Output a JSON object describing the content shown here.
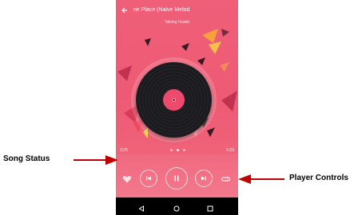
{
  "screen": {
    "song_title": "ne Place (Naive Melod",
    "artist": "Talking Heads",
    "elapsed_time": "3:25",
    "total_time": "6:23"
  },
  "annotations": {
    "song_status": "Song Status",
    "player_controls": "Player Controls"
  },
  "icons": {
    "back": "back-arrow-icon",
    "like": "heart-icon",
    "previous": "skip-previous-icon",
    "play_pause": "pause-icon",
    "next": "skip-next-icon",
    "repeat": "repeat-icon",
    "nav_back": "nav-back-icon",
    "nav_home": "nav-home-icon",
    "nav_recents": "nav-recents-icon"
  },
  "colors": {
    "background": "#ef5f78",
    "record_label": "#ec4b6d",
    "arrow": "#c00000"
  }
}
